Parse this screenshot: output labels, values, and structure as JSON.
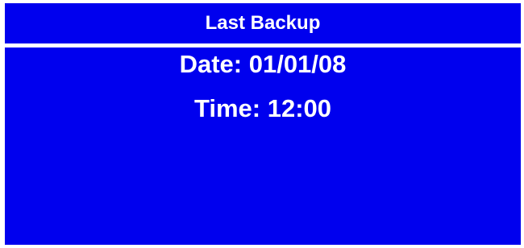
{
  "header": {
    "title": "Last Backup"
  },
  "backup": {
    "date_label": "Date: 01/01/08",
    "time_label": "Time: 12:00"
  },
  "colors": {
    "panel_background": "#0000ee",
    "text": "#ffffff"
  }
}
